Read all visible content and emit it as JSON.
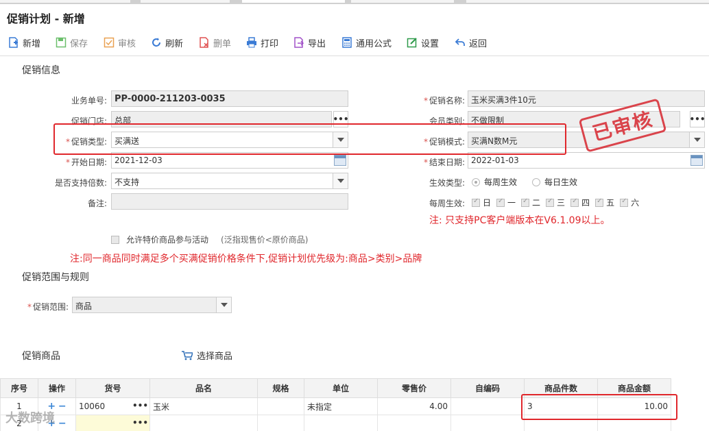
{
  "page_title": "促销计划 - 新增",
  "toolbar": {
    "new": "新增",
    "save": "保存",
    "audit": "审核",
    "refresh": "刷新",
    "delete": "删单",
    "print": "打印",
    "export": "导出",
    "formula": "通用公式",
    "settings": "设置",
    "back": "返回"
  },
  "section_info": "促销信息",
  "form": {
    "doc_no_label": "业务单号:",
    "doc_no_value": "PP-0000-211203-0035",
    "store_label": "促销门店:",
    "store_value": "总部",
    "type_label": "促销类型:",
    "type_value": "买满送",
    "start_label": "开始日期:",
    "start_value": "2021-12-03",
    "multiple_label": "是否支持倍数:",
    "multiple_value": "不支持",
    "remark_label": "备注:",
    "name_label": "促销名称:",
    "name_value": "玉米买满3件10元",
    "member_label": "会员类别:",
    "member_value": "不做限制",
    "mode_label": "促销模式:",
    "mode_value": "买满N数M元",
    "end_label": "结束日期:",
    "end_value": "2022-01-03",
    "effect_type_label": "生效类型:",
    "effect_weekly": "每周生效",
    "effect_daily": "每日生效",
    "weekly_label": "每周生效:",
    "weekdays": [
      "日",
      "一",
      "二",
      "三",
      "四",
      "五",
      "六"
    ],
    "pc_note": "注: 只支持PC客户端版本在V6.1.09以上。",
    "special_price_label": "允许特价商品参与活动",
    "special_price_hint": "(泛指现售价<原价商品)",
    "priority_note": "注:同一商品同时满足多个买满促销价格条件下,促销计划优先级为:商品>类别>品牌"
  },
  "stamp": "已审核",
  "section_scope": "促销范围与规则",
  "scope_label": "促销范围:",
  "scope_value": "商品",
  "section_goods": "促销商品",
  "select_goods": "选择商品",
  "table": {
    "headers": [
      "序号",
      "操作",
      "货号",
      "品名",
      "规格",
      "单位",
      "零售价",
      "自编码",
      "商品件数",
      "商品金额"
    ],
    "rows": [
      {
        "no": "1",
        "code": "10060",
        "name": "玉米",
        "spec": "",
        "unit": "未指定",
        "price": "4.00",
        "selfcode": "",
        "qty": "3",
        "amount": "10.00"
      },
      {
        "no": "2",
        "code": "",
        "name": "",
        "spec": "",
        "unit": "",
        "price": "",
        "selfcode": "",
        "qty": "",
        "amount": ""
      }
    ]
  },
  "watermark": "大数跨境"
}
